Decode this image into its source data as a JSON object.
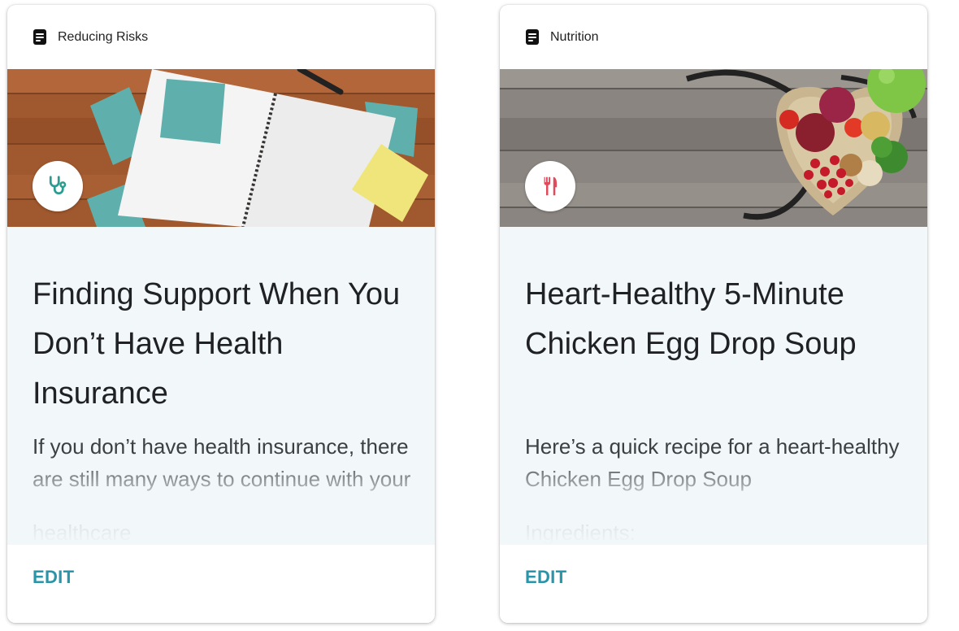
{
  "cards": [
    {
      "category": "Reducing Risks",
      "category_icon": "document-icon",
      "badge_icon": "stethoscope-icon",
      "badge_color": "#2a9d8f",
      "title": "Finding Support When You Don’t Have Health Insurance",
      "description": "If you don’t have health insurance, there are still many ways to continue with your",
      "description_extra": "healthcare",
      "action": "EDIT"
    },
    {
      "category": "Nutrition",
      "category_icon": "document-icon",
      "badge_icon": "fork-knife-icon",
      "badge_color": "#e04a5a",
      "title": "Heart-Healthy 5-Minute Chicken Egg Drop Soup",
      "description": "Here’s a quick recipe for a heart-healthy Chicken Egg Drop Soup",
      "description_extra": "Ingredients:",
      "action": "EDIT"
    }
  ],
  "accent_color": "#2a94a8"
}
